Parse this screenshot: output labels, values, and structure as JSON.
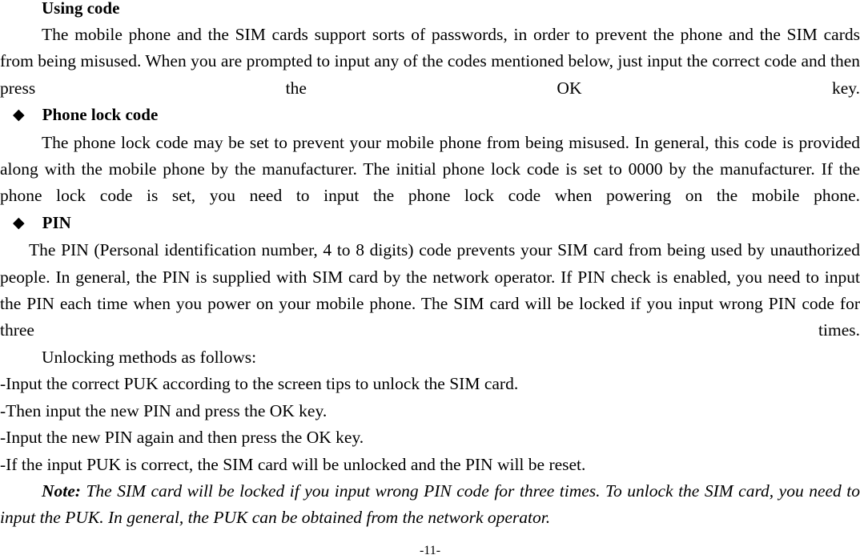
{
  "document": {
    "page_number_label": "-11-",
    "bullet_glyph": "◆"
  },
  "section": {
    "heading": "Using code",
    "intro_paragraph": "The mobile phone and the SIM cards support sorts of passwords, in order to prevent the phone and the SIM cards from being misused. When you are prompted to input any of the codes mentioned below, just input the correct code and then press the OK key."
  },
  "phone_lock": {
    "heading": "Phone lock code",
    "paragraph": "The phone lock code may be set to prevent your mobile phone from being misused. In general, this code is provided along with the mobile phone by the manufacturer. The initial phone lock code is set to 0000 by the manufacturer. If the phone lock code is set, you need to input the phone lock code when powering on the mobile phone."
  },
  "pin": {
    "heading": "PIN",
    "paragraph": "The PIN (Personal identification number, 4 to 8 digits) code prevents your SIM card from being used by unauthorized people. In general, the PIN is supplied with SIM card by the network operator. If PIN check is enabled, you need to input the PIN each time when you power on your mobile phone. The SIM card will be locked if you input wrong PIN code for three times.",
    "unlocking_intro": "Unlocking methods as follows:",
    "steps": [
      "-Input the correct PUK according to the screen tips to unlock the SIM card.",
      "-Then input the new PIN and press the OK key.",
      "-Input the new PIN again and then press the OK key.",
      "-If the input PUK is correct, the SIM card will be unlocked and the PIN will be reset."
    ],
    "note_label": "Note:",
    "note_text": " The SIM card will be locked if you input wrong PIN code for three times. To unlock the SIM card, you need to input the PUK. In general, the PUK can be obtained from the network operator."
  }
}
